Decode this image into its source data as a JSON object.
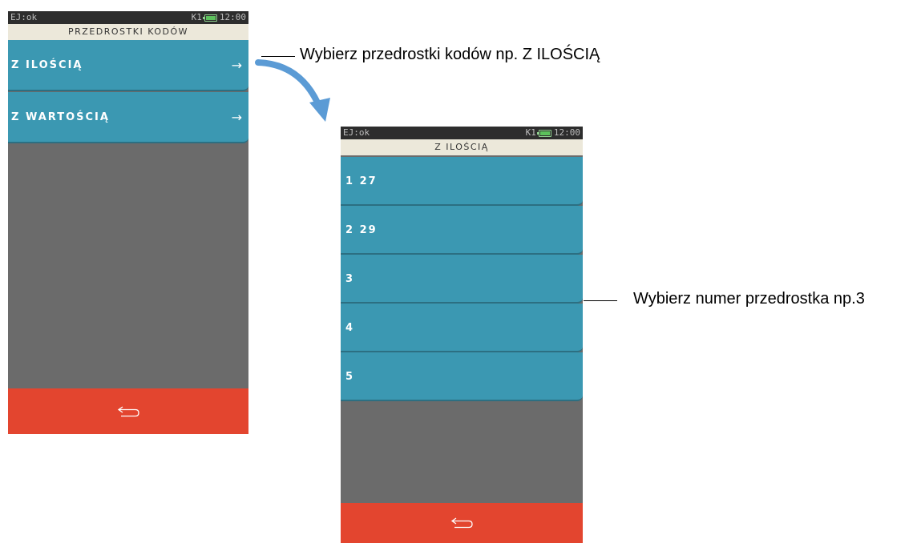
{
  "screen1": {
    "status": {
      "left": "EJ:ok",
      "right_label": "K1",
      "time": "12:00"
    },
    "title": "PRZEDROSTKI KODÓW",
    "items": [
      {
        "label": "Z ILOŚCIĄ",
        "arrow": "→"
      },
      {
        "label": "Z WARTOŚCIĄ",
        "arrow": "→"
      }
    ],
    "back_icon": "return-arrow-icon"
  },
  "screen2": {
    "status": {
      "left": "EJ:ok",
      "right_label": "K1",
      "time": "12:00"
    },
    "title": "Z ILOŚCIĄ",
    "items": [
      {
        "label": "1 27"
      },
      {
        "label": "2 29"
      },
      {
        "label": "3"
      },
      {
        "label": "4"
      },
      {
        "label": "5"
      }
    ],
    "back_icon": "return-arrow-icon"
  },
  "annotations": {
    "top": "Wybierz przedrostki kodów np. Z ILOŚCIĄ",
    "right": "Wybierz numer przedrostka np.3"
  },
  "colors": {
    "item_bg": "#3b98b2",
    "back_bar": "#e3452f",
    "screen_bg": "#6b6b6b",
    "title_bg": "#ece8da",
    "status_bg": "#2d2d2d",
    "flow_arrow": "#5b9bd5"
  }
}
